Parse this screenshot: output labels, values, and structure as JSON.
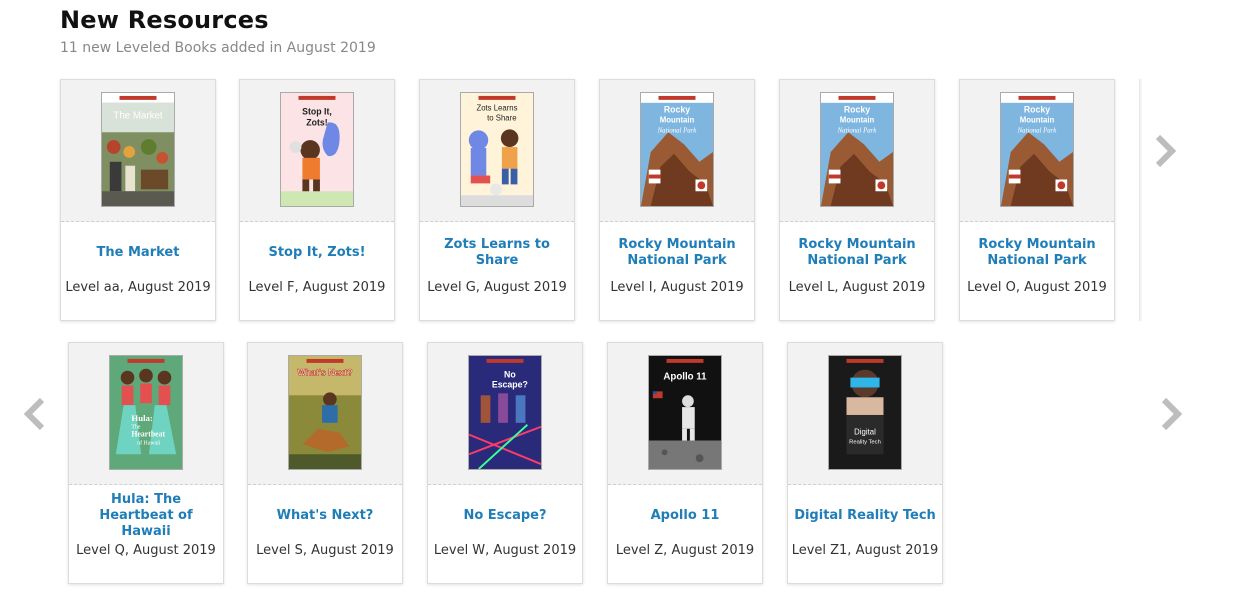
{
  "header": {
    "title": "New Resources",
    "subtitle": "11 new Leveled Books added in August 2019"
  },
  "carousel1": {
    "books": [
      {
        "title": "The Market",
        "meta": "Level aa, August 2019"
      },
      {
        "title": "Stop It, Zots!",
        "meta": "Level F, August 2019"
      },
      {
        "title": "Zots Learns to Share",
        "meta": "Level G, August 2019"
      },
      {
        "title": "Rocky Mountain National Park",
        "meta": "Level I, August 2019"
      },
      {
        "title": "Rocky Mountain National Park",
        "meta": "Level L, August 2019"
      },
      {
        "title": "Rocky Mountain National Park",
        "meta": "Level O, August 2019"
      }
    ]
  },
  "carousel2": {
    "books": [
      {
        "title": "Hula: The Heartbeat of Hawaii",
        "meta": "Level Q, August 2019"
      },
      {
        "title": "What's Next?",
        "meta": "Level S, August 2019"
      },
      {
        "title": "No Escape?",
        "meta": "Level W, August 2019"
      },
      {
        "title": "Apollo 11",
        "meta": "Level Z, August 2019"
      },
      {
        "title": "Digital Reality Tech",
        "meta": "Level Z1, August 2019"
      }
    ]
  },
  "covers": {
    "market": {
      "text": "The Market"
    },
    "stop_zots": {
      "text1": "Stop It,",
      "text2": "Zots!"
    },
    "zots_share": {
      "text1": "Zots Learns",
      "text2": "to Share"
    },
    "rocky": {
      "text1": "Rocky",
      "text2": "Mountain",
      "text3": "National Park"
    },
    "hula": {
      "text1": "Hula:",
      "text2": "The",
      "text3": "Heartbeat",
      "text4": "of Hawaii"
    },
    "whats_next": {
      "text": "What's Next?"
    },
    "no_escape": {
      "text1": "No",
      "text2": "Escape?"
    },
    "apollo": {
      "text": "Apollo 11"
    },
    "digital": {
      "text1": "Digital",
      "text2": "Reality Tech"
    }
  },
  "icons": {
    "next": "chevron-right-icon",
    "prev": "chevron-left-icon"
  },
  "colors": {
    "link": "#1f7db8",
    "arrow": "#bdbdbd",
    "card_border": "#dcdcdc",
    "cover_bg": "#f2f2f2"
  }
}
